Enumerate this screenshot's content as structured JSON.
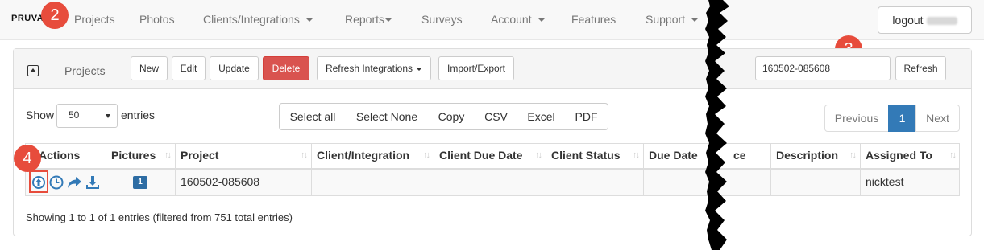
{
  "navbar": {
    "brand": "PRUVAN",
    "items": [
      {
        "label": "Projects",
        "dropdown": false
      },
      {
        "label": "Photos",
        "dropdown": false
      },
      {
        "label": "Clients/Integrations",
        "dropdown": true
      },
      {
        "label": "Reports",
        "dropdown": true
      },
      {
        "label": "Surveys",
        "dropdown": false
      },
      {
        "label": "Account",
        "dropdown": true
      },
      {
        "label": "Features",
        "dropdown": false
      },
      {
        "label": "Support",
        "dropdown": true
      }
    ],
    "logout_label": "logout"
  },
  "callouts": [
    "2",
    "3",
    "4"
  ],
  "panel": {
    "title": "Projects",
    "buttons": {
      "new": "New",
      "edit": "Edit",
      "update": "Update",
      "delete": "Delete",
      "refresh_integrations": "Refresh Integrations",
      "import_export": "Import/Export",
      "refresh": "Refresh"
    },
    "search_value": "160502-085608"
  },
  "table_controls": {
    "show_label": "Show",
    "entries_label": "entries",
    "page_length": "50",
    "export_buttons": [
      "Select all",
      "Select None",
      "Copy",
      "CSV",
      "Excel",
      "PDF"
    ],
    "pagination": {
      "previous": "Previous",
      "current": "1",
      "next": "Next"
    }
  },
  "table": {
    "columns": [
      "Actions",
      "Pictures",
      "Project",
      "Client/Integration",
      "Client Due Date",
      "Client Status",
      "Due Date",
      "ce",
      "Description",
      "Assigned To"
    ],
    "rows": [
      {
        "actions": [
          "upload-icon",
          "clock-icon",
          "share-icon",
          "download-icon"
        ],
        "pictures": "1",
        "project": "160502-085608",
        "client_integration": "",
        "client_due_date": "",
        "client_status": "",
        "due_date": "",
        "ce": "",
        "description": "",
        "assigned_to": "nicktest"
      }
    ]
  },
  "info": "Showing 1 to 1 of 1 entries (filtered from 751 total entries)",
  "colors": {
    "callout": "#e74c3c",
    "primary": "#337ab7",
    "danger": "#d9534f"
  }
}
